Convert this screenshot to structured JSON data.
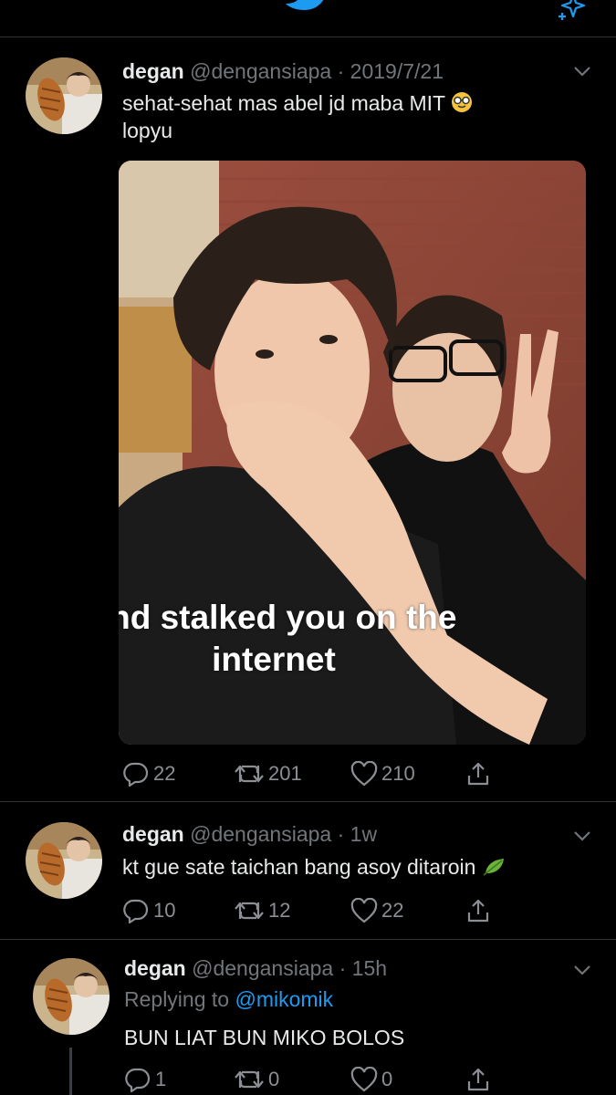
{
  "header": {
    "logo_icon": "twitter-bird-icon",
    "sparkle_icon": "sparkle-icon"
  },
  "colors": {
    "accent": "#1d9bf0",
    "background": "#000000",
    "muted": "#71767b",
    "divider": "#2f3336"
  },
  "tweets": [
    {
      "name": "degan",
      "handle": "@dengansiapa",
      "time": "2019/7/21",
      "text_line1": "sehat-sehat mas abel jd maba MIT",
      "emoji": "nerd-face-emoji",
      "text_line2": "lopyu",
      "media": {
        "overlay_line1": "and stalked you on the",
        "overlay_line2": "internet"
      },
      "replies": "22",
      "retweets": "201",
      "likes": "210"
    },
    {
      "name": "degan",
      "handle": "@dengansiapa",
      "time": "1w",
      "text": "kt gue sate taichan bang asoy ditaroin",
      "emoji": "leaf-emoji",
      "replies": "10",
      "retweets": "12",
      "likes": "22"
    },
    {
      "name": "degan",
      "handle": "@dengansiapa",
      "time": "15h",
      "replying_prefix": "Replying to",
      "replying_mention": "@mikomik",
      "text": "BUN LIAT BUN MIKO BOLOS",
      "replies": "1",
      "retweets": "0",
      "likes": "0"
    }
  ]
}
